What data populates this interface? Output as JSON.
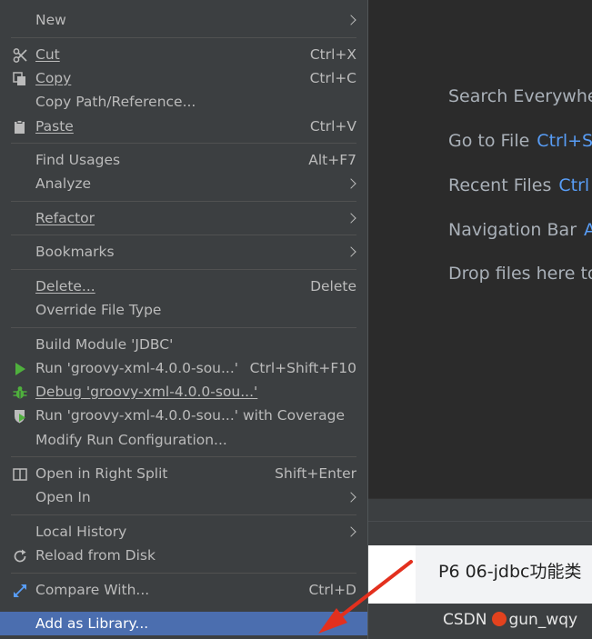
{
  "editor_hints": [
    {
      "label": "Search Everywhe",
      "key": ""
    },
    {
      "label": "Go to File",
      "key": "Ctrl+S"
    },
    {
      "label": "Recent Files",
      "key": "Ctrl"
    },
    {
      "label": "Navigation Bar",
      "key": "A"
    },
    {
      "label": "Drop files here to",
      "key": ""
    }
  ],
  "bottom_panel": {
    "text": "P6   06-jdbc功能类"
  },
  "watermark": {
    "prefix": "CSDN",
    "handle": "gun_wqy"
  },
  "colors": {
    "menu_bg": "#3c3f41",
    "selection": "#4b6eaf",
    "shortcut_key": "#589df6",
    "run_green": "#4fb03d",
    "arrow_red": "#e3301e"
  },
  "menu": {
    "new": {
      "label": "New"
    },
    "cut": {
      "label": "Cut",
      "shortcut": "Ctrl+X",
      "icon": "scissors-icon"
    },
    "copy": {
      "label": "Copy",
      "shortcut": "Ctrl+C",
      "icon": "copy-icon"
    },
    "copy_path": {
      "label": "Copy Path/Reference..."
    },
    "paste": {
      "label": "Paste",
      "shortcut": "Ctrl+V",
      "icon": "clipboard-icon"
    },
    "find_usages": {
      "label": "Find Usages",
      "shortcut": "Alt+F7"
    },
    "analyze": {
      "label": "Analyze"
    },
    "refactor": {
      "label": "Refactor"
    },
    "bookmarks": {
      "label": "Bookmarks"
    },
    "delete": {
      "label": "Delete...",
      "shortcut": "Delete"
    },
    "override_file_type": {
      "label": "Override File Type"
    },
    "build_module": {
      "label": "Build Module 'JDBC'"
    },
    "run": {
      "label": "Run 'groovy-xml-4.0.0-sou...'",
      "shortcut": "Ctrl+Shift+F10",
      "icon": "run-icon"
    },
    "debug": {
      "label": "Debug 'groovy-xml-4.0.0-sou...'",
      "icon": "bug-icon"
    },
    "run_coverage": {
      "label": "Run 'groovy-xml-4.0.0-sou...' with Coverage",
      "icon": "coverage-icon"
    },
    "modify_run_config": {
      "label": "Modify Run Configuration..."
    },
    "open_right_split": {
      "label": "Open in Right Split",
      "shortcut": "Shift+Enter",
      "icon": "split-icon"
    },
    "open_in": {
      "label": "Open In"
    },
    "local_history": {
      "label": "Local History"
    },
    "reload_from_disk": {
      "label": "Reload from Disk",
      "icon": "reload-icon"
    },
    "compare_with": {
      "label": "Compare With...",
      "shortcut": "Ctrl+D",
      "icon": "compare-icon"
    },
    "add_as_library": {
      "label": "Add as Library..."
    }
  }
}
